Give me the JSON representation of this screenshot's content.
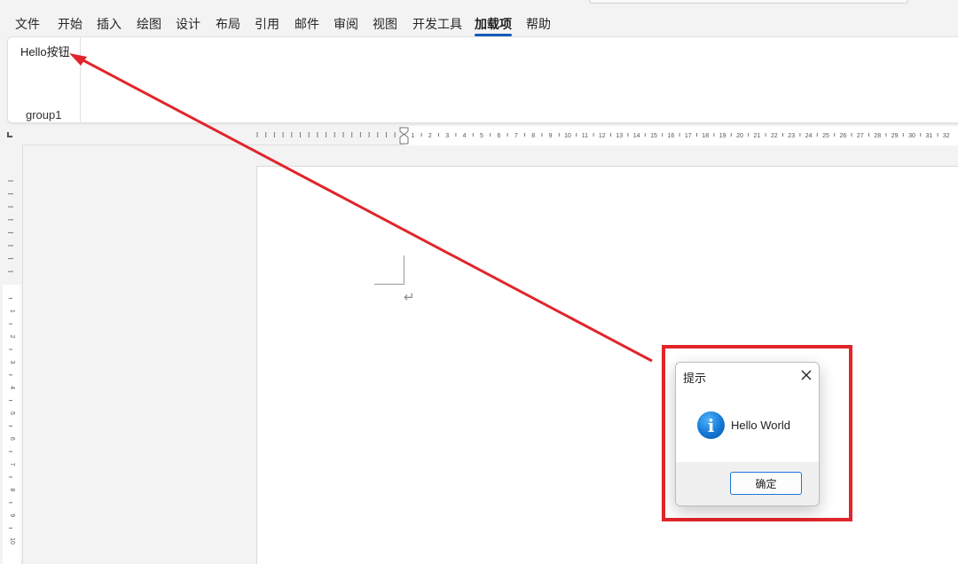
{
  "menu": {
    "tabs": [
      "文件",
      "开始",
      "插入",
      "绘图",
      "设计",
      "布局",
      "引用",
      "邮件",
      "审阅",
      "视图",
      "开发工具",
      "加载项",
      "帮助"
    ],
    "active_tab": "加载项"
  },
  "ribbon": {
    "button_label": "Hello按钮",
    "group_label": "group1"
  },
  "ruler": {
    "horizontal_labels": [
      "1",
      "2",
      "3",
      "4",
      "5",
      "6",
      "7",
      "8",
      "9",
      "10",
      "11",
      "12",
      "13",
      "14",
      "15",
      "16",
      "17",
      "18",
      "19",
      "20",
      "21",
      "22",
      "23",
      "24",
      "25",
      "26",
      "27",
      "28",
      "29",
      "30",
      "31",
      "32"
    ],
    "vertical_labels": [
      "1",
      "2",
      "3",
      "4",
      "5",
      "6",
      "7",
      "8",
      "9",
      "10"
    ]
  },
  "document": {
    "paragraph_mark": "↵"
  },
  "dialog": {
    "title": "提示",
    "close_icon": "close-icon",
    "icon": "info-icon",
    "icon_glyph": "i",
    "message": "Hello World",
    "ok_label": "确定"
  },
  "annotation": {
    "color": "#e0262b"
  },
  "colors": {
    "accent": "#185abd",
    "dialog_button_border": "#1979d6",
    "info_icon": "#1478d4"
  }
}
